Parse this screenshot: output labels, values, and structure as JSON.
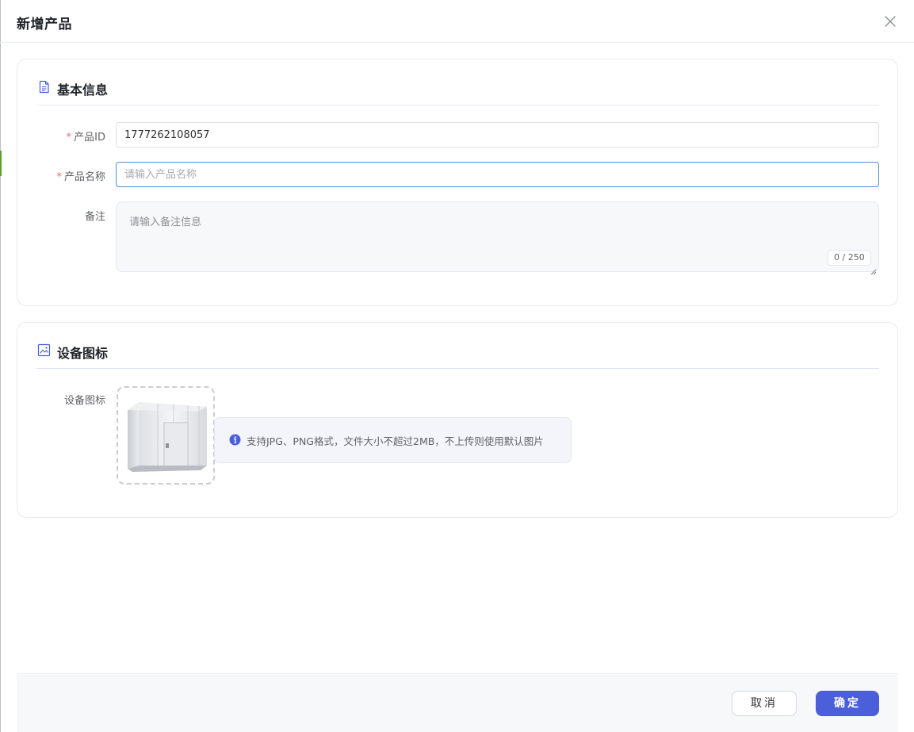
{
  "dialog": {
    "title": "新增产品",
    "close_icon": "close-icon"
  },
  "basic_info": {
    "title": "基本信息",
    "icon": "document-icon",
    "product_id": {
      "label": "产品ID",
      "required": "*",
      "value": "1777262108057"
    },
    "product_name": {
      "label": "产品名称",
      "required": "*",
      "value": "",
      "placeholder": "请输入产品名称"
    },
    "remark": {
      "label": "备注",
      "value": "",
      "placeholder": "请输入备注信息",
      "counter": "0 / 250"
    }
  },
  "device_icon": {
    "title": "设备图标",
    "icon": "image-icon",
    "field_label": "设备图标",
    "tip_icon": "info-icon",
    "tip": "支持JPG、PNG格式，文件大小不超过2MB，不上传则使用默认图片"
  },
  "footer": {
    "cancel_label": "取消",
    "confirm_label": "确定"
  },
  "colors": {
    "primary": "#4a5fd9",
    "required": "#f56c6c",
    "focus_border": "#4a90d9"
  }
}
